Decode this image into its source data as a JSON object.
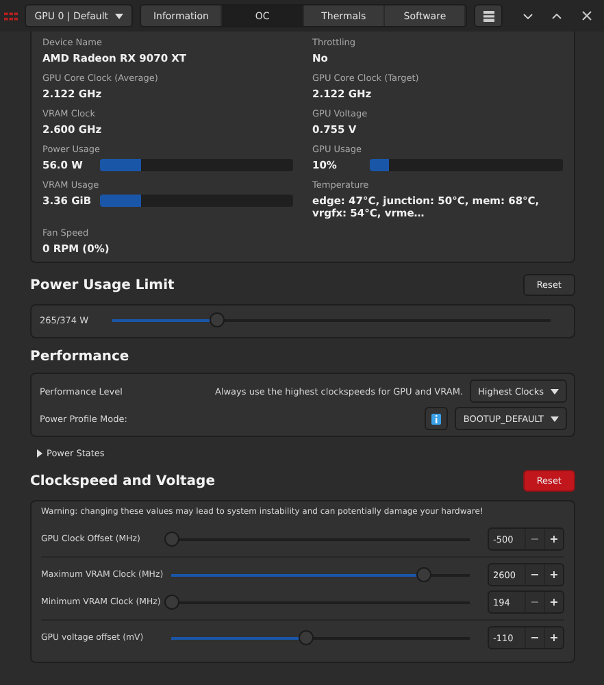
{
  "header": {
    "gpu_selector": "GPU 0 | Default",
    "tabs": [
      {
        "label": "Information",
        "selected": false
      },
      {
        "label": "OC",
        "selected": true
      },
      {
        "label": "Thermals",
        "selected": false
      },
      {
        "label": "Software",
        "selected": false
      }
    ]
  },
  "info": {
    "items": [
      {
        "kind": "text",
        "label": "Device Name",
        "value": "AMD Radeon RX 9070 XT"
      },
      {
        "kind": "text",
        "label": "Throttling",
        "value": "No"
      },
      {
        "kind": "text",
        "label": "GPU Core Clock (Average)",
        "value": "2.122 GHz"
      },
      {
        "kind": "text",
        "label": "GPU Core Clock (Target)",
        "value": "2.122 GHz"
      },
      {
        "kind": "text",
        "label": "VRAM Clock",
        "value": "2.600 GHz"
      },
      {
        "kind": "text",
        "label": "GPU Voltage",
        "value": "0.755 V"
      },
      {
        "kind": "bar",
        "label": "Power Usage",
        "value": "56.0 W",
        "level": 0.21
      },
      {
        "kind": "bar",
        "label": "GPU Usage",
        "value": "10%",
        "level": 0.1
      },
      {
        "kind": "bar",
        "label": "VRAM Usage",
        "value": "3.36 GiB",
        "level": 0.21
      },
      {
        "kind": "text",
        "label": "Temperature",
        "value": "edge: 47°C, junction: 50°C, mem: 68°C, vrgfx: 54°C, vrme…"
      },
      {
        "kind": "text",
        "label": "Fan Speed",
        "value": "0 RPM (0%)"
      }
    ]
  },
  "power_limit": {
    "title": "Power Usage Limit",
    "reset": {
      "label": "Reset",
      "danger": false
    },
    "reading": "265/374 W",
    "level": 0.24
  },
  "performance": {
    "title": "Performance",
    "rows": [
      {
        "kind": "level",
        "label": "Performance Level",
        "description": "Always use the highest clockspeeds for GPU and VRAM.",
        "dropdown": "Highest Clocks"
      },
      {
        "kind": "profile",
        "label": "Power Profile Mode:",
        "dropdown": "BOOTUP_DEFAULT"
      }
    ]
  },
  "power_states": {
    "label": "Power States",
    "expanded": false
  },
  "clocks": {
    "title": "Clockspeed and Voltage",
    "reset": {
      "label": "Reset",
      "danger": true
    },
    "warning": "Warning: changing these values may lead to system instability and can potentially damage your hardware!",
    "groups": [
      [
        {
          "label": "GPU Clock Offset (MHz)",
          "level": 0,
          "value": "-500",
          "minus": "−",
          "minus_disabled": true,
          "plus": "+"
        }
      ],
      [
        {
          "label": "Maximum VRAM Clock (MHz)",
          "level": 0.85,
          "value": "2600",
          "minus": "−",
          "minus_disabled": false,
          "plus": "+"
        },
        {
          "label": "Minimum VRAM Clock (MHz)",
          "level": 0,
          "value": "194",
          "minus": "−",
          "minus_disabled": true,
          "plus": "+"
        }
      ],
      [
        {
          "label": "GPU voltage offset (mV)",
          "level": 0.45,
          "value": "-110",
          "minus": "−",
          "minus_disabled": false,
          "plus": "+"
        }
      ]
    ]
  }
}
